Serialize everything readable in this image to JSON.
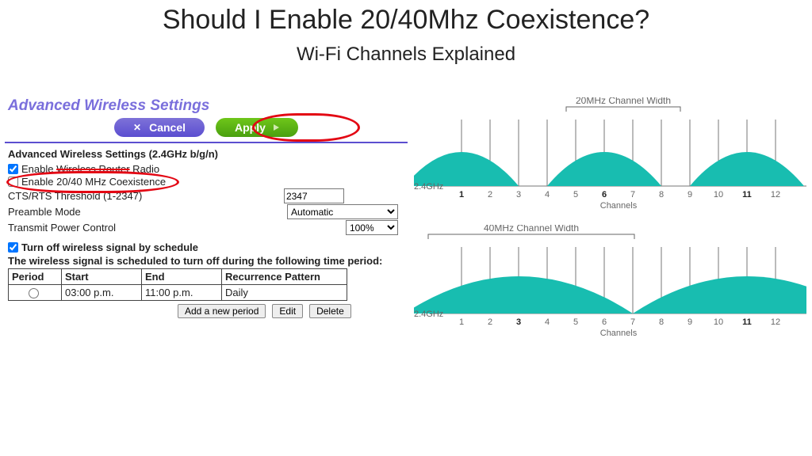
{
  "title": "Should I Enable 20/40Mhz Coexistence?",
  "subtitle": "Wi-Fi Channels Explained",
  "panel": {
    "heading": "Advanced Wireless Settings",
    "cancel_label": "Cancel",
    "apply_label": "Apply",
    "section_title": "Advanced Wireless Settings (2.4GHz b/g/n)",
    "enable_radio_label": "Enable Wireless Router Radio",
    "enable_coex_label": "Enable 20/40 MHz Coexistence",
    "cts_label": "CTS/RTS Threshold (1-2347)",
    "cts_value": "2347",
    "preamble_label": "Preamble Mode",
    "preamble_value": "Automatic",
    "tpc_label": "Transmit Power Control",
    "tpc_value": "100%",
    "sched_toggle": "Turn off wireless signal by schedule",
    "sched_note": "The wireless signal is scheduled to turn off during the following time period:",
    "table": {
      "headers": [
        "Period",
        "Start",
        "End",
        "Recurrence Pattern"
      ],
      "row": {
        "start": "03:00 p.m.",
        "end": "11:00 p.m.",
        "recur": "Daily"
      }
    },
    "add_label": "Add a new period",
    "edit_label": "Edit",
    "delete_label": "Delete"
  },
  "chart_data": [
    {
      "type": "area",
      "title": "20MHz Channel Width",
      "xlabel": "Channels",
      "left_axis": "2.4GHz",
      "channel_ticks": [
        1,
        2,
        3,
        4,
        5,
        6,
        7,
        8,
        9,
        10,
        11,
        12
      ],
      "center_channels": [
        1,
        6,
        11
      ],
      "channel_width_mhz": 20,
      "bracket_span": [
        4,
        8
      ],
      "series": [
        {
          "name": "ch1",
          "center": 1,
          "span": [
            -1,
            3
          ]
        },
        {
          "name": "ch6",
          "center": 6,
          "span": [
            4,
            8
          ]
        },
        {
          "name": "ch11",
          "center": 11,
          "span": [
            9,
            13
          ]
        }
      ]
    },
    {
      "type": "area",
      "title": "40MHz Channel Width",
      "xlabel": "Channels",
      "left_axis": "2.4GHz",
      "channel_ticks": [
        1,
        2,
        3,
        4,
        5,
        6,
        7,
        8,
        9,
        10,
        11,
        12
      ],
      "center_channels": [
        3,
        11
      ],
      "channel_width_mhz": 40,
      "bracket_span": [
        -1,
        7
      ],
      "series": [
        {
          "name": "ch3",
          "center": 3,
          "span": [
            -1,
            7
          ]
        },
        {
          "name": "ch11",
          "center": 11,
          "span": [
            7,
            15
          ]
        }
      ]
    }
  ]
}
